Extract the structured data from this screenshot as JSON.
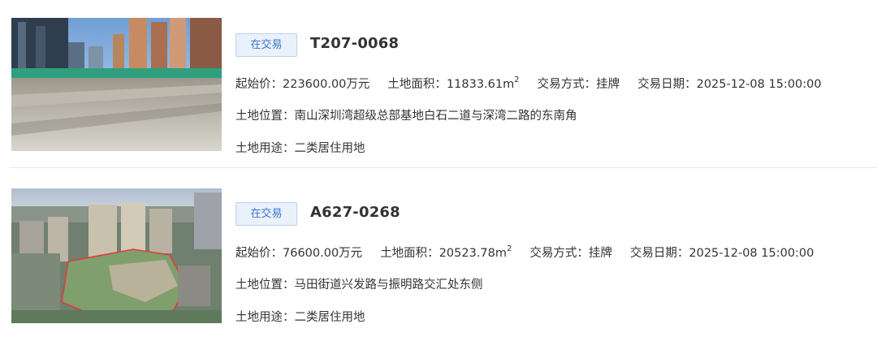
{
  "listings": [
    {
      "status": "在交易",
      "code": "T207-0068",
      "start_price_label": "起始价：",
      "start_price": "223600.00万元",
      "area_label": "土地面积：",
      "area": "11833.61m",
      "area_unit_sup": "2",
      "method_label": "交易方式：",
      "method": "挂牌",
      "date_label": "交易日期：",
      "date": "2025-12-08 15:00:00",
      "location_label": "土地位置：",
      "location": "南山深圳湾超级总部基地白石二道与深湾二路的东南角",
      "usage_label": "土地用途：",
      "usage": "二类居住用地"
    },
    {
      "status": "在交易",
      "code": "A627-0268",
      "start_price_label": "起始价：",
      "start_price": "76600.00万元",
      "area_label": "土地面积：",
      "area": "20523.78m",
      "area_unit_sup": "2",
      "method_label": "交易方式：",
      "method": "挂牌",
      "date_label": "交易日期：",
      "date": "2025-12-08 15:00:00",
      "location_label": "土地位置：",
      "location": "马田街道兴发路与振明路交汇处东侧",
      "usage_label": "土地用途：",
      "usage": "二类居住用地"
    }
  ],
  "colors": {
    "badge_bg": "#eaf1fb",
    "badge_text": "#3a78c8",
    "text": "#333333",
    "divider": "#e6e6e6"
  }
}
